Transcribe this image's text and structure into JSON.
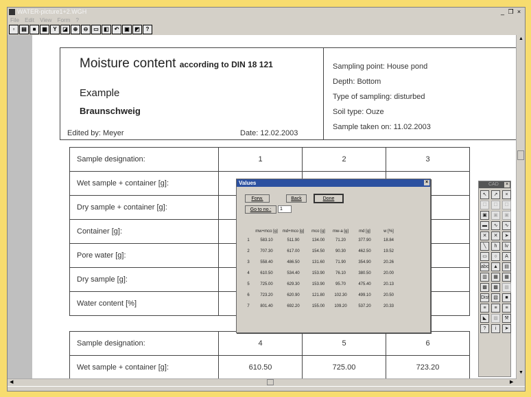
{
  "window": {
    "title": "WATER-picture1+2.WGH",
    "controls": [
      "_",
      "❐",
      "×"
    ]
  },
  "menu": [
    "File",
    "Edit",
    "View",
    "Form",
    "?"
  ],
  "toolbar": {
    "icons": [
      "new-icon",
      "open-icon",
      "save-icon",
      "print-icon",
      "filter-icon",
      "insert-icon",
      "zoom-in-icon",
      "zoom-out-icon",
      "frame-icon",
      "page-icon",
      "undo-icon",
      "copy-icon",
      "paste-icon",
      "help-icon"
    ],
    "help_label": "?"
  },
  "header": {
    "title": "Moisture content",
    "title_suffix": "according to DIN 18 121",
    "example": "Example",
    "city": "Braunschweig",
    "edited_by": "Edited by:  Meyer",
    "date": "Date:  12.02.2003",
    "info": [
      "Sampling point:  House pond",
      "Depth:  Bottom",
      "Type of sampling:  disturbed",
      "Soil type:  Ouze",
      "Sample taken on:  11.02.2003"
    ]
  },
  "table1": {
    "rows": [
      {
        "label": "Sample designation:",
        "values": [
          "1",
          "2",
          "3"
        ]
      },
      {
        "label": "Wet sample + container [g]:",
        "values": [
          "",
          "",
          ""
        ]
      },
      {
        "label": "Dry sample + container [g]:",
        "values": [
          "",
          "",
          ""
        ]
      },
      {
        "label": "Container [g]:",
        "values": [
          "",
          "",
          ""
        ]
      },
      {
        "label": "Pore water [g]:",
        "values": [
          "",
          "",
          ""
        ]
      },
      {
        "label": "Dry sample [g]:",
        "values": [
          "",
          "",
          ""
        ]
      },
      {
        "label": "Water content [%]",
        "values": [
          "",
          "",
          ""
        ]
      }
    ]
  },
  "table2": {
    "rows": [
      {
        "label": "Sample designation:",
        "values": [
          "4",
          "5",
          "6"
        ]
      },
      {
        "label": "Wet sample + container [g]:",
        "values": [
          "610.50",
          "725.00",
          "723.20"
        ]
      }
    ]
  },
  "dialog": {
    "title": "Values",
    "close": "×",
    "forw": "Forw.",
    "back": "Back",
    "done": "Done",
    "goto": "Go to no.:",
    "goto_value": "1",
    "columns": [
      "",
      "mw+mco [g]",
      "md+mco [g]",
      "mco [g]",
      "mw-a [g]",
      "md [g]",
      "w [%]"
    ],
    "rows": [
      [
        "1",
        "583.10",
        "511.90",
        "134.00",
        "71.20",
        "377.90",
        "18.84"
      ],
      [
        "2",
        "707.30",
        "617.00",
        "154.50",
        "90.30",
        "462.50",
        "19.52"
      ],
      [
        "3",
        "558.40",
        "486.50",
        "131.60",
        "71.90",
        "354.90",
        "20.26"
      ],
      [
        "4",
        "610.50",
        "534.40",
        "153.90",
        "76.10",
        "380.50",
        "20.00"
      ],
      [
        "5",
        "725.00",
        "629.30",
        "153.90",
        "95.70",
        "475.40",
        "20.13"
      ],
      [
        "6",
        "723.20",
        "620.90",
        "121.80",
        "102.30",
        "499.10",
        "20.50"
      ],
      [
        "7",
        "801.40",
        "692.20",
        "155.00",
        "109.20",
        "537.20",
        "20.33"
      ]
    ]
  },
  "palette": {
    "title": "CAD",
    "close": "×",
    "buttons": [
      "↖",
      "↗",
      "×",
      "☐",
      "☐",
      "☐",
      "▣",
      "▣",
      "▣",
      "▬",
      "∿",
      "∿",
      "✕",
      "✕",
      "➤",
      "╲",
      "h",
      "lv",
      "▭",
      "○",
      "A",
      "abc",
      "▲",
      "▤",
      "▥",
      "▦",
      "▦",
      "▩",
      "▩",
      "▩",
      "Dist",
      "▧",
      "■",
      "≡",
      "≡",
      "≡",
      "◣",
      "▩",
      "⚒",
      "?",
      "i",
      "➤"
    ]
  }
}
